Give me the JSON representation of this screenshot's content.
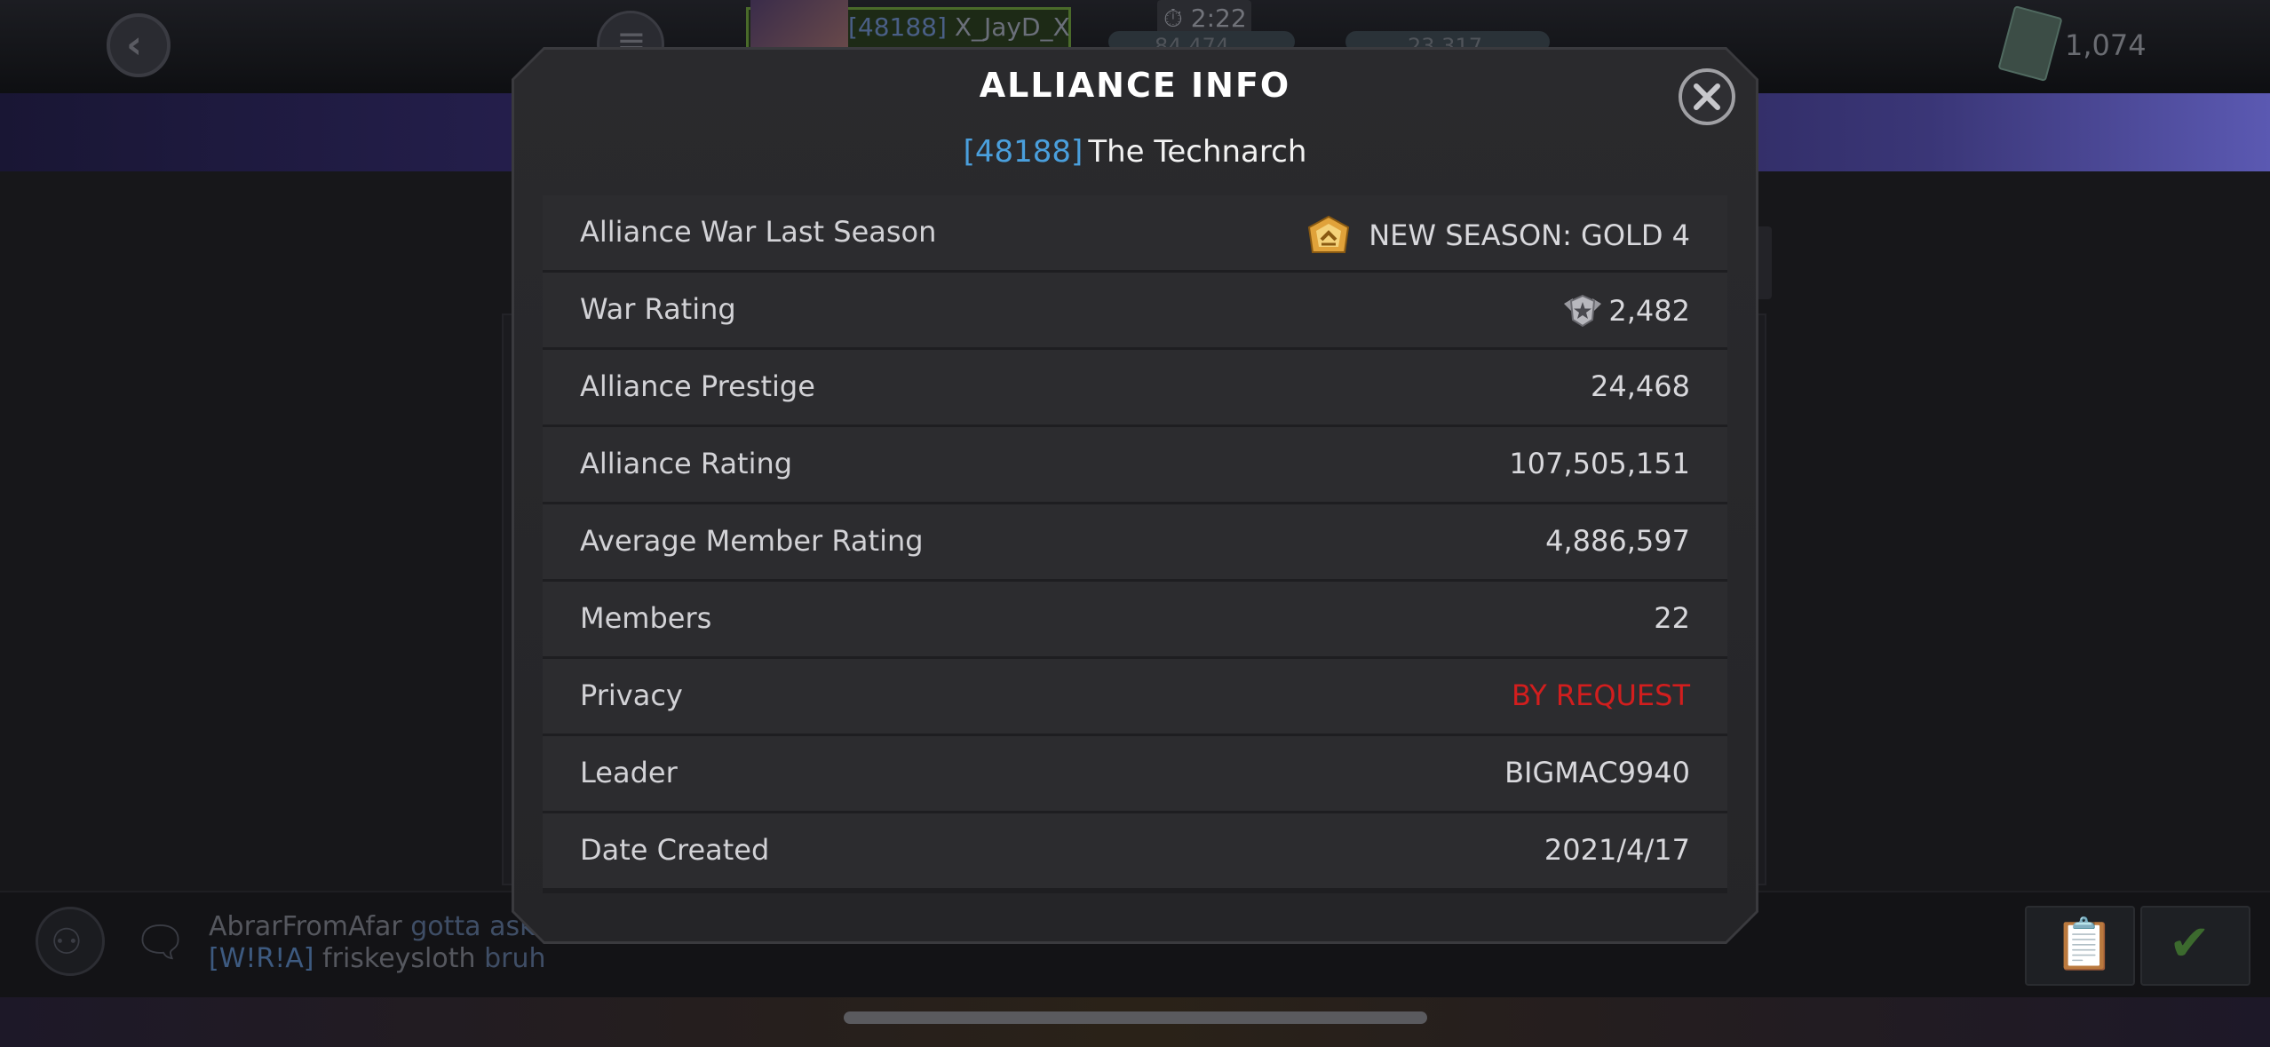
{
  "background": {
    "player_tag": "[48188]",
    "player_name": "X_JayD_X",
    "timer": "2:22",
    "resource_1": "84,474",
    "resource_2": "23,317",
    "units": "1,074",
    "chat": [
      {
        "tag": "",
        "user": "AbrarFromAfar",
        "message": "gotta ask"
      },
      {
        "tag": "[W!R!A]",
        "user": "friskeysloth",
        "message": "bruh"
      }
    ]
  },
  "modal": {
    "title": "ALLIANCE INFO",
    "alliance_tag": "[48188]",
    "alliance_name": "The Technarch",
    "rows": [
      {
        "label": "Alliance War Last Season",
        "value": "NEW SEASON: GOLD 4",
        "icon": "gold-tier-icon"
      },
      {
        "label": "War Rating",
        "value": "2,482",
        "icon": "war-rating-icon"
      },
      {
        "label": "Alliance Prestige",
        "value": "24,468"
      },
      {
        "label": "Alliance Rating",
        "value": "107,505,151"
      },
      {
        "label": "Average Member Rating",
        "value": "4,886,597"
      },
      {
        "label": "Members",
        "value": "22"
      },
      {
        "label": "Privacy",
        "value": "BY REQUEST",
        "color": "#d21e1e"
      },
      {
        "label": "Leader",
        "value": "BIGMAC9940"
      },
      {
        "label": "Date Created",
        "value": "2021/4/17"
      }
    ]
  },
  "colors": {
    "tag_blue": "#4a9fdc",
    "privacy_red": "#d21e1e",
    "gold": "#e0a23a"
  }
}
